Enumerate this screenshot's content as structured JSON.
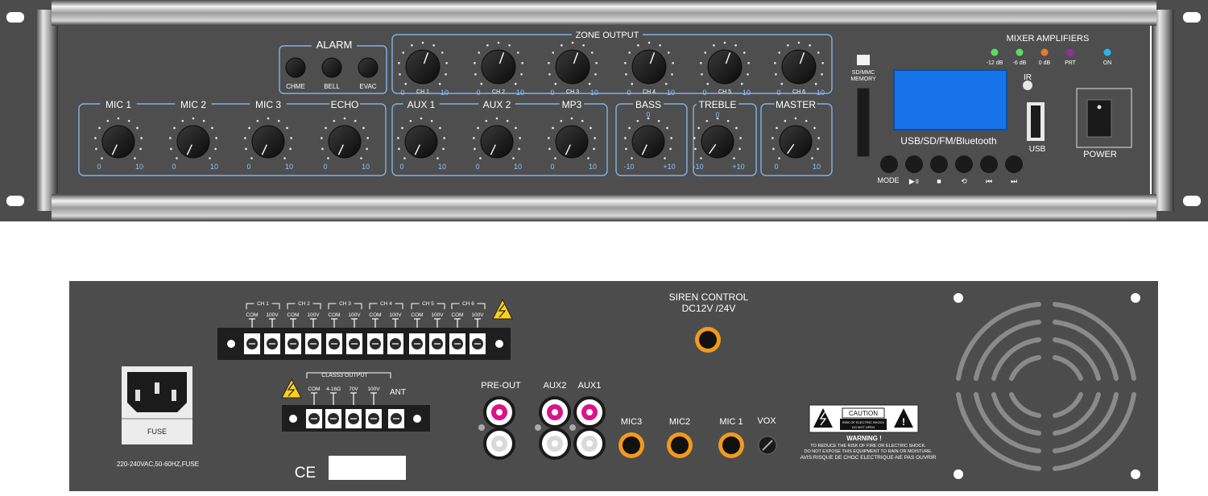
{
  "front": {
    "alarm": {
      "title": "ALARM",
      "buttons": [
        "CHME",
        "BELL",
        "EVAC"
      ]
    },
    "zone_output": {
      "title": "ZONE OUTPUT",
      "channels": [
        "CH 1",
        "CH 2",
        "CH 3",
        "CH 4",
        "CH 5",
        "CH 6"
      ],
      "scale_min": "0",
      "scale_max": "10"
    },
    "inputs": [
      {
        "label": "MIC 1",
        "min": "0",
        "max": "10"
      },
      {
        "label": "MIC 2",
        "min": "0",
        "max": "10"
      },
      {
        "label": "MIC 3",
        "min": "0",
        "max": "10"
      },
      {
        "label": "ECHO",
        "min": "0",
        "max": "10"
      },
      {
        "label": "AUX 1",
        "min": "0",
        "max": "10"
      },
      {
        "label": "AUX 2",
        "min": "0",
        "max": "10"
      },
      {
        "label": "MP3",
        "min": "0",
        "max": "10"
      },
      {
        "label": "BASS",
        "min": "-10",
        "max": "+10",
        "center": "0"
      },
      {
        "label": "TREBLE",
        "min": "-10",
        "max": "+10",
        "center": "0"
      },
      {
        "label": "MASTER",
        "min": "0",
        "max": "10"
      }
    ],
    "media": {
      "sd_label": "SD/MMC\nMEMORY",
      "display_caption": "USB/SD/FM/Bluetooth",
      "ir_label": "IR",
      "usb_label": "USB",
      "mode_label": "MODE",
      "transport_icons": [
        "play-pause-icon",
        "stop-icon",
        "repeat-icon",
        "previous-track-icon",
        "next-track-icon"
      ],
      "transport_glyphs": [
        "▶॥",
        "■",
        "⟲",
        "⏮",
        "⏭"
      ]
    },
    "mixer": {
      "title": "MIXER AMPLIFIERS",
      "leds": [
        {
          "label": "-12 dB",
          "color": "#5fdc5f"
        },
        {
          "label": "-6 dB",
          "color": "#5fdc5f"
        },
        {
          "label": "0 dB",
          "color": "#e87a2a"
        },
        {
          "label": "PRT",
          "color": "#9a2aa8"
        },
        {
          "label": "ON",
          "color": "#2ab7e8"
        }
      ]
    },
    "power_label": "POWER"
  },
  "rear": {
    "speaker_channels": [
      "CH 1",
      "CH 2",
      "CH 3",
      "CH 4",
      "CH 5",
      "CH 6"
    ],
    "terminal_labels": [
      "COM",
      "100V"
    ],
    "siren": {
      "line1": "SIREN CONTROL",
      "line2": "DC12V /24V"
    },
    "class3": {
      "title": "CLASS3 OUTPUT",
      "terminals": [
        "COM",
        "4-16Ω",
        "70V",
        "100V"
      ],
      "ant_label": "ANT"
    },
    "jacks": {
      "pre_out": "PRE-OUT",
      "aux2": "AUX2",
      "aux1": "AUX1",
      "mic3": "MIC3",
      "mic2": "MIC2",
      "mic1": "MIC 1",
      "vox": "VOX"
    },
    "fuse_label": "FUSE",
    "power_spec": "220-240VAC,50-60HZ,FUSE",
    "ce_mark": "CE",
    "caution": {
      "title": "CAUTION",
      "sub1": "RISK OF ELECTRIC SHOCK",
      "sub2": "DO NOT OPEN",
      "warning": "WARNING !",
      "line1": "TO REDUCE THE RISK OF FIRE OR ELECTRIC SHOCK.",
      "line2": "DO NOT EXPOSE THIS EQUIPMENT TO RAIN OR MOISTURE.",
      "line3": "AVIS:RISQUE DE CHOC ELECTRIQUE-NE PAS OUVRIR"
    }
  }
}
